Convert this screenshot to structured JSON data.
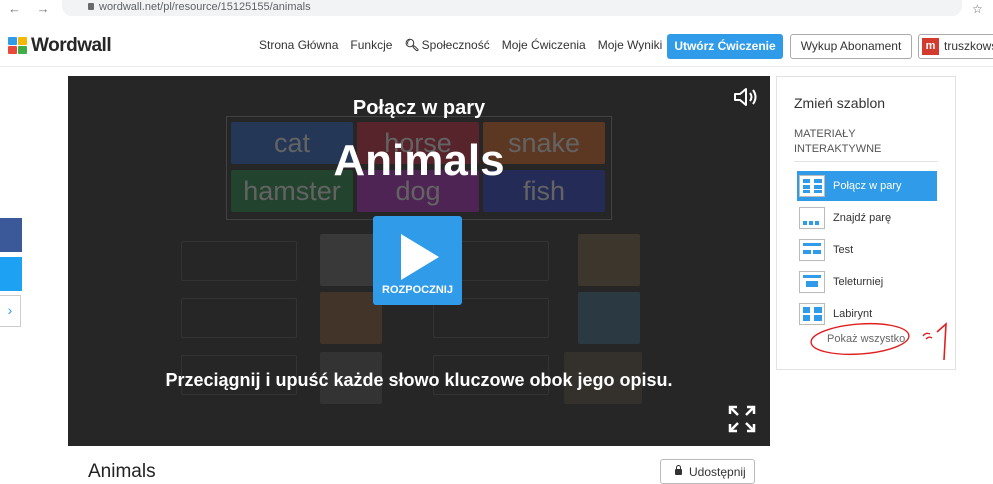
{
  "browser": {
    "url": "wordwall.net/pl/resource/15125155/animals"
  },
  "header": {
    "logo_text": "Wordwall",
    "nav": [
      "Strona Główna",
      "Funkcje",
      "Społeczność",
      "Moje Ćwiczenia",
      "Moje Wyniki"
    ],
    "create_label": "Utwórz Ćwiczenie",
    "subscribe_label": "Wykup Abonament",
    "user_initial": "m",
    "user_name": "truszkows"
  },
  "game": {
    "template_name": "Połącz w pary",
    "title": "Animals",
    "start_label": "ROZPOCZNIJ",
    "instruction": "Przeciągnij i upuść każde słowo kluczowe obok jego opisu.",
    "background_words": [
      "cat",
      "horse",
      "snake",
      "hamster",
      "dog",
      "fish"
    ]
  },
  "resource": {
    "title": "Animals",
    "share_label": "Udostępnij"
  },
  "sidebar": {
    "heading": "Zmień szablon",
    "section_label": "MATERIAŁY INTERAKTYWNE",
    "templates": [
      {
        "label": "Połącz w pary",
        "active": true
      },
      {
        "label": "Znajdź parę",
        "active": false
      },
      {
        "label": "Test",
        "active": false
      },
      {
        "label": "Teleturniej",
        "active": false
      },
      {
        "label": "Labirynt",
        "active": false
      }
    ],
    "show_all": "Pokaż wszystko"
  },
  "colors": {
    "accent": "#2f9be9",
    "game_bg": "#262626",
    "annotation": "#e02020"
  }
}
